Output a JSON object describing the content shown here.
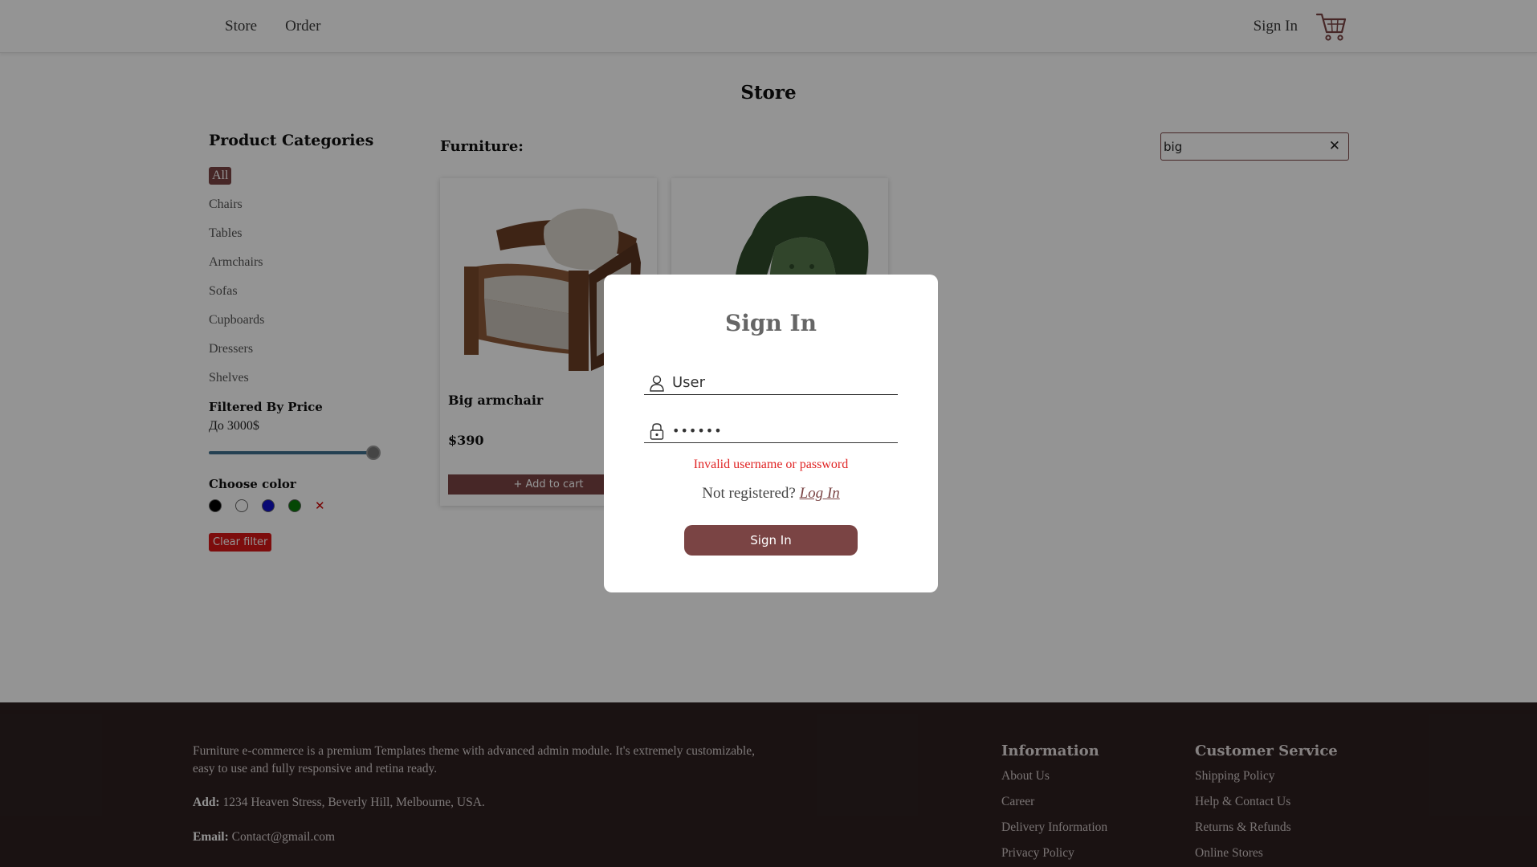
{
  "header": {
    "nav": [
      "Store",
      "Order"
    ],
    "signin_label": "Sign In",
    "cart_icon": "cart-icon"
  },
  "page": {
    "title": "Store"
  },
  "sidebar": {
    "categories_heading": "Product Categories",
    "categories": [
      "All",
      "Chairs",
      "Tables",
      "Armchairs",
      "Sofas",
      "Cupboards",
      "Dressers",
      "Shelves"
    ],
    "active_category": "All",
    "price_heading": "Filtered By Price",
    "price_value": "До 3000$",
    "price_slider_fraction": 1.0,
    "color_heading": "Choose color",
    "colors": [
      "#000000",
      "#ffffff",
      "#1010c8",
      "#0a7a0a"
    ],
    "clear_color_symbol": "✕",
    "clear_filter_label": "Clear filter"
  },
  "main": {
    "section_heading": "Furniture:",
    "search_value": "big",
    "search_clear_symbol": "✕",
    "products": [
      {
        "name": "Big armchair",
        "price": "$390",
        "add_label": "+ Add to cart"
      },
      {
        "name": "",
        "price": "",
        "add_label": ""
      }
    ]
  },
  "footer": {
    "about": "Furniture e-commerce is a premium Templates theme with advanced admin module. It's extremely customizable, easy to use and fully responsive and retina ready.",
    "address_label": "Add:",
    "address": "1234 Heaven Stress, Beverly Hill, Melbourne, USA.",
    "email_label": "Email:",
    "email": "Contact@gmail.com",
    "information_heading": "Information",
    "information_links": [
      "About Us",
      "Career",
      "Delivery Information",
      "Privacy Policy"
    ],
    "service_heading": "Customer Service",
    "service_links": [
      "Shipping Policy",
      "Help & Contact Us",
      "Returns & Refunds",
      "Online Stores"
    ]
  },
  "modal": {
    "title": "Sign In",
    "username_value": "User",
    "password_value": "••••••",
    "error": "Invalid username or password",
    "register_prompt": "Not registered?",
    "register_link": "Log In",
    "submit_label": "Sign In"
  }
}
